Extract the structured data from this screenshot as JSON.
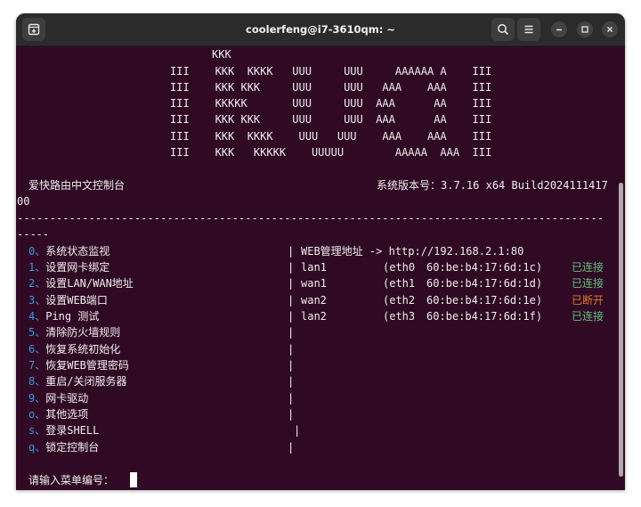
{
  "window": {
    "title": "coolerfeng@i7-3610qm: ~"
  },
  "icons": {
    "new_tab": "new-tab-icon",
    "search": "search-icon",
    "menu": "hamburger-menu-icon",
    "minimize": "minimize-icon",
    "maximize": "maximize-icon",
    "close": "close-icon"
  },
  "banner": [
    "KKK",
    "III    KKK  KKKK   UUU     UUU     AAAAAA A    III",
    "III    KKK KKK     UUU     UUU   AAA    AAA    III",
    "III    KKKKK       UUU     UUU  AAA      AA    III",
    "III    KKK KKK     UUU     UUU  AAA      AA    III",
    "III    KKK  KKKK    UUU   UUU    AAA    AAA    III",
    "III    KKK   KKKKK    UUUUU        AAAAA  AAA  III"
  ],
  "header": {
    "app_name": "爱快路由中文控制台",
    "version_label": "系统版本号：",
    "version_value": "3.7.16 x64 Build2024111417",
    "version_wrap": "00"
  },
  "divider": {
    "line1": "------------------------------------------------------------------------------------------",
    "line2": "-----"
  },
  "menu": [
    {
      "key": "0、",
      "label": "系统状态监视"
    },
    {
      "key": "1、",
      "label": "设置网卡绑定"
    },
    {
      "key": "2、",
      "label": "设置LAN/WAN地址"
    },
    {
      "key": "3、",
      "label": "设置WEB端口"
    },
    {
      "key": "4、",
      "label": "Ping 测试"
    },
    {
      "key": "5、",
      "label": "清除防火墙规则"
    },
    {
      "key": "6、",
      "label": "恢复系统初始化"
    },
    {
      "key": "7、",
      "label": "恢复WEB管理密码"
    },
    {
      "key": "8、",
      "label": "重启/关闭服务器"
    },
    {
      "key": "9、",
      "label": "网卡驱动"
    },
    {
      "key": "o、",
      "label": "其他选项"
    },
    {
      "key": "s、",
      "label": "登录SHELL"
    },
    {
      "key": "q、",
      "label": "锁定控制台"
    }
  ],
  "web_admin": {
    "label": "WEB管理地址",
    "arrow": "->",
    "url": "http://192.168.2.1:80"
  },
  "interfaces": [
    {
      "name": "lan1",
      "eth": "(eth0",
      "mac": "60:be:b4:17:6d:1c)",
      "status": "已连接"
    },
    {
      "name": "wan1",
      "eth": "(eth1",
      "mac": "60:be:b4:17:6d:1d)",
      "status": "已连接"
    },
    {
      "name": "wan2",
      "eth": "(eth2",
      "mac": "60:be:b4:17:6d:1e)",
      "status": "已断开"
    },
    {
      "name": "lan2",
      "eth": "(eth3",
      "mac": "60:be:b4:17:6d:1f)",
      "status": "已连接"
    }
  ],
  "separator": "|",
  "prompt": "请输入菜单编号：",
  "colors": {
    "background": "#300a24",
    "menu_number": "#3a96dd",
    "connected": "#5fc080",
    "disconnected": "#d87a30"
  }
}
